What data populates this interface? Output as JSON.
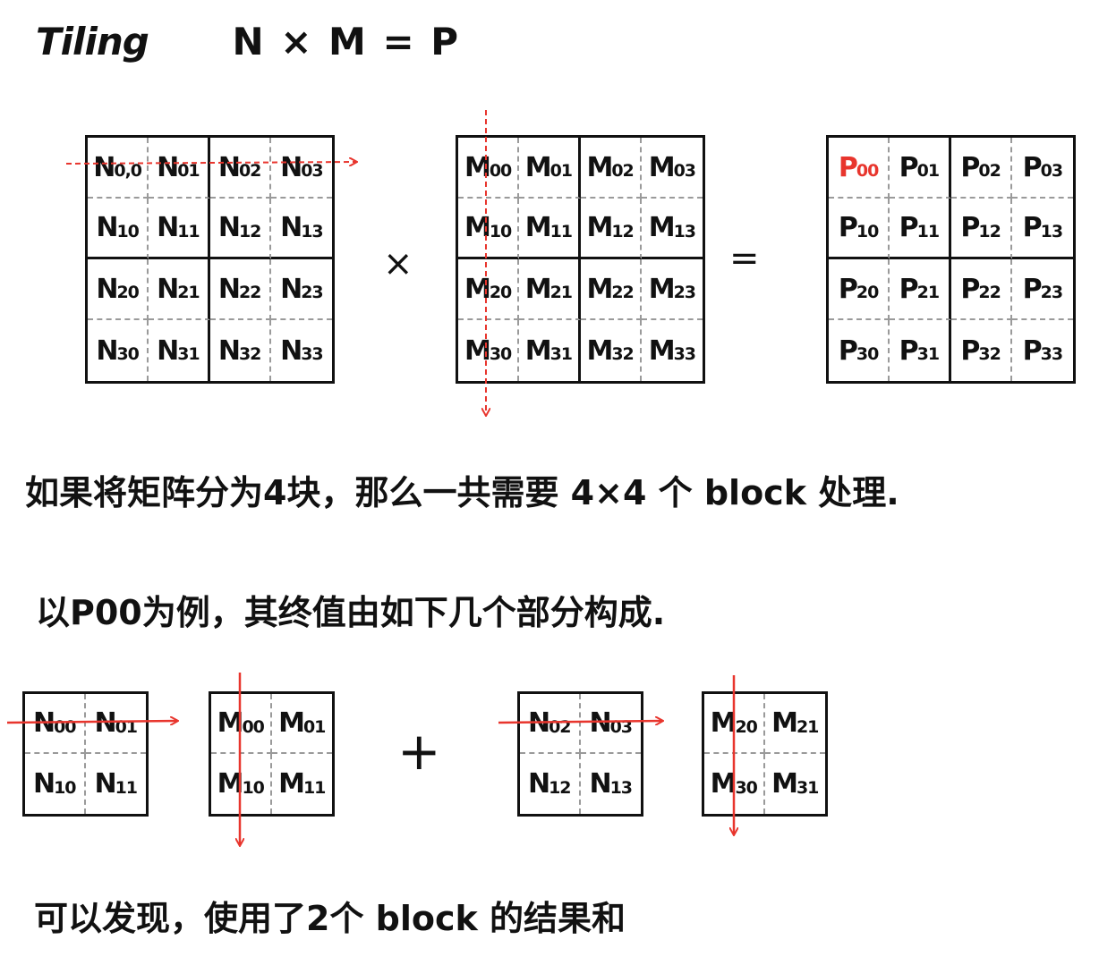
{
  "title": {
    "tiling": "Tiling",
    "equation": "N × M = P"
  },
  "operators": {
    "times": "×",
    "equals": "=",
    "plus": "+"
  },
  "matrices": {
    "N": [
      [
        "N",
        "0,0"
      ],
      [
        "N",
        "01"
      ],
      [
        "N",
        "02"
      ],
      [
        "N",
        "03"
      ],
      [
        "N",
        "10"
      ],
      [
        "N",
        "11"
      ],
      [
        "N",
        "12"
      ],
      [
        "N",
        "13"
      ],
      [
        "N",
        "20"
      ],
      [
        "N",
        "21"
      ],
      [
        "N",
        "22"
      ],
      [
        "N",
        "23"
      ],
      [
        "N",
        "30"
      ],
      [
        "N",
        "31"
      ],
      [
        "N",
        "32"
      ],
      [
        "N",
        "33"
      ]
    ],
    "M": [
      [
        "M",
        "00"
      ],
      [
        "M",
        "01"
      ],
      [
        "M",
        "02"
      ],
      [
        "M",
        "03"
      ],
      [
        "M",
        "10"
      ],
      [
        "M",
        "11"
      ],
      [
        "M",
        "12"
      ],
      [
        "M",
        "13"
      ],
      [
        "M",
        "20"
      ],
      [
        "M",
        "21"
      ],
      [
        "M",
        "22"
      ],
      [
        "M",
        "23"
      ],
      [
        "M",
        "30"
      ],
      [
        "M",
        "31"
      ],
      [
        "M",
        "32"
      ],
      [
        "M",
        "33"
      ]
    ],
    "P": [
      [
        "P",
        "00"
      ],
      [
        "P",
        "01"
      ],
      [
        "P",
        "02"
      ],
      [
        "P",
        "03"
      ],
      [
        "P",
        "10"
      ],
      [
        "P",
        "11"
      ],
      [
        "P",
        "12"
      ],
      [
        "P",
        "13"
      ],
      [
        "P",
        "20"
      ],
      [
        "P",
        "21"
      ],
      [
        "P",
        "22"
      ],
      [
        "P",
        "23"
      ],
      [
        "P",
        "30"
      ],
      [
        "P",
        "31"
      ],
      [
        "P",
        "32"
      ],
      [
        "P",
        "33"
      ]
    ]
  },
  "highlight_cell": "P00",
  "lines": {
    "line1": "如果将矩阵分为4块，那么一共需要 4×4 个 block 处理.",
    "line2": "以P00为例，其终值由如下几个部分构成.",
    "line3": "可以发现，使用了2个 block 的结果和"
  },
  "blocks": {
    "N_block_a": [
      [
        "N",
        "00"
      ],
      [
        "N",
        "01"
      ],
      [
        "N",
        "10"
      ],
      [
        "N",
        "11"
      ]
    ],
    "M_block_a": [
      [
        "M",
        "00"
      ],
      [
        "M",
        "01"
      ],
      [
        "M",
        "10"
      ],
      [
        "M",
        "11"
      ]
    ],
    "N_block_b": [
      [
        "N",
        "02"
      ],
      [
        "N",
        "03"
      ],
      [
        "N",
        "12"
      ],
      [
        "N",
        "13"
      ]
    ],
    "M_block_b": [
      [
        "M",
        "20"
      ],
      [
        "M",
        "21"
      ],
      [
        "M",
        "30"
      ],
      [
        "M",
        "31"
      ]
    ]
  },
  "colors": {
    "ink": "#111111",
    "red": "#e8352d",
    "dash": "#9a9a9a"
  }
}
